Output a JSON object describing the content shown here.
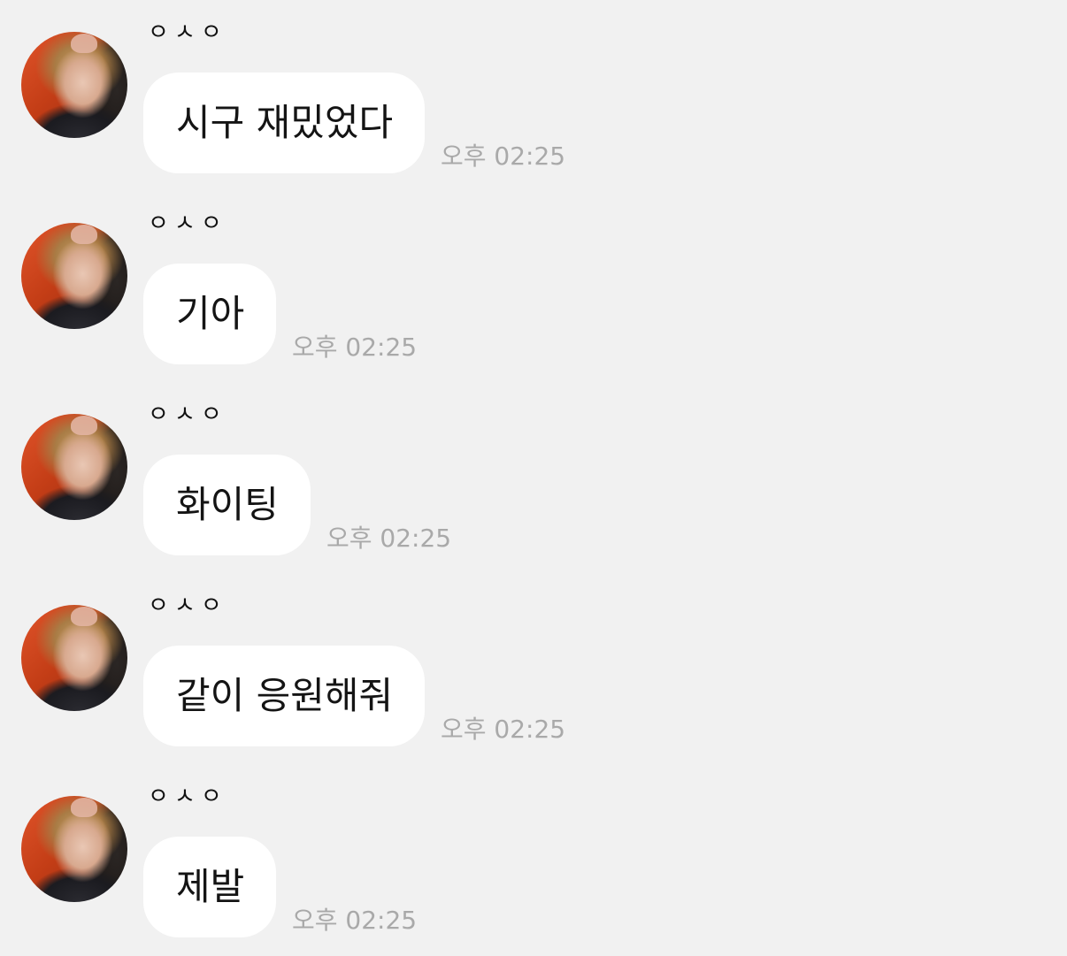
{
  "chat": {
    "messages": [
      {
        "sender": "ㅇㅅㅇ",
        "text": "시구 재밌었다",
        "time": "오후 02:25"
      },
      {
        "sender": "ㅇㅅㅇ",
        "text": "기아",
        "time": "오후 02:25"
      },
      {
        "sender": "ㅇㅅㅇ",
        "text": "화이팅",
        "time": "오후 02:25"
      },
      {
        "sender": "ㅇㅅㅇ",
        "text": "같이 응원해줘",
        "time": "오후 02:25"
      },
      {
        "sender": "ㅇㅅㅇ",
        "text": "제발",
        "time": "오후 02:25"
      }
    ]
  },
  "colors": {
    "background": "#f1f1f1",
    "bubble": "#ffffff",
    "time_text": "#a9a9a9"
  },
  "icons": {
    "avatar": "profile-photo"
  }
}
